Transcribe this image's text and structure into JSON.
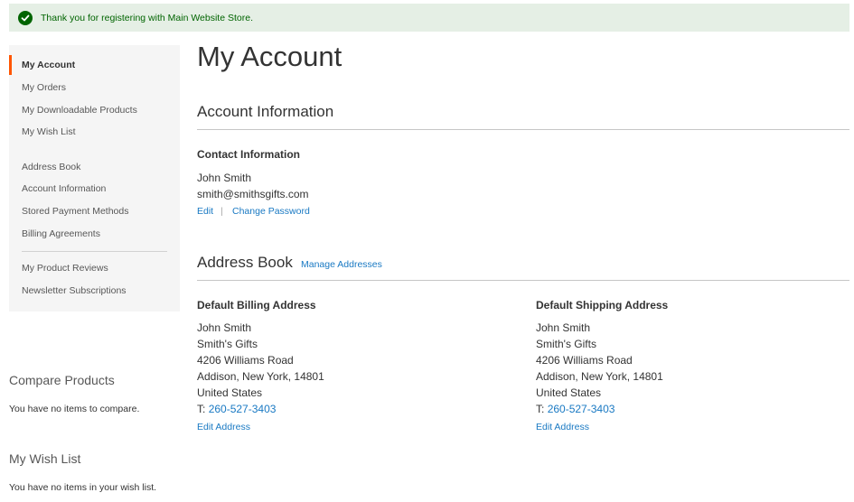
{
  "notice": {
    "message": "Thank you for registering with Main Website Store."
  },
  "sidebar": {
    "items": [
      {
        "label": "My Account"
      },
      {
        "label": "My Orders"
      },
      {
        "label": "My Downloadable Products"
      },
      {
        "label": "My Wish List"
      },
      {
        "label": "Address Book"
      },
      {
        "label": "Account Information"
      },
      {
        "label": "Stored Payment Methods"
      },
      {
        "label": "Billing Agreements"
      },
      {
        "label": "My Product Reviews"
      },
      {
        "label": "Newsletter Subscriptions"
      }
    ]
  },
  "compare": {
    "title": "Compare Products",
    "empty": "You have no items to compare."
  },
  "wishlist": {
    "title": "My Wish List",
    "empty": "You have no items in your wish list."
  },
  "main": {
    "title": "My Account",
    "account_info": {
      "heading": "Account Information",
      "contact_title": "Contact Information",
      "name": "John Smith",
      "email": "smith@smithsgifts.com",
      "edit_label": "Edit",
      "separator": "|",
      "change_password_label": "Change Password"
    },
    "address_book": {
      "heading": "Address Book",
      "manage_label": "Manage Addresses",
      "billing": {
        "title": "Default Billing Address",
        "name": "John Smith",
        "company": "Smith's Gifts",
        "street": "4206 Williams Road",
        "city_line": "Addison, New York, 14801",
        "country": "United States",
        "phone_prefix": "T:",
        "phone": "260-527-3403",
        "edit_label": "Edit Address"
      },
      "shipping": {
        "title": "Default Shipping Address",
        "name": "John Smith",
        "company": "Smith's Gifts",
        "street": "4206 Williams Road",
        "city_line": "Addison, New York, 14801",
        "country": "United States",
        "phone_prefix": "T:",
        "phone": "260-527-3403",
        "edit_label": "Edit Address"
      }
    }
  }
}
